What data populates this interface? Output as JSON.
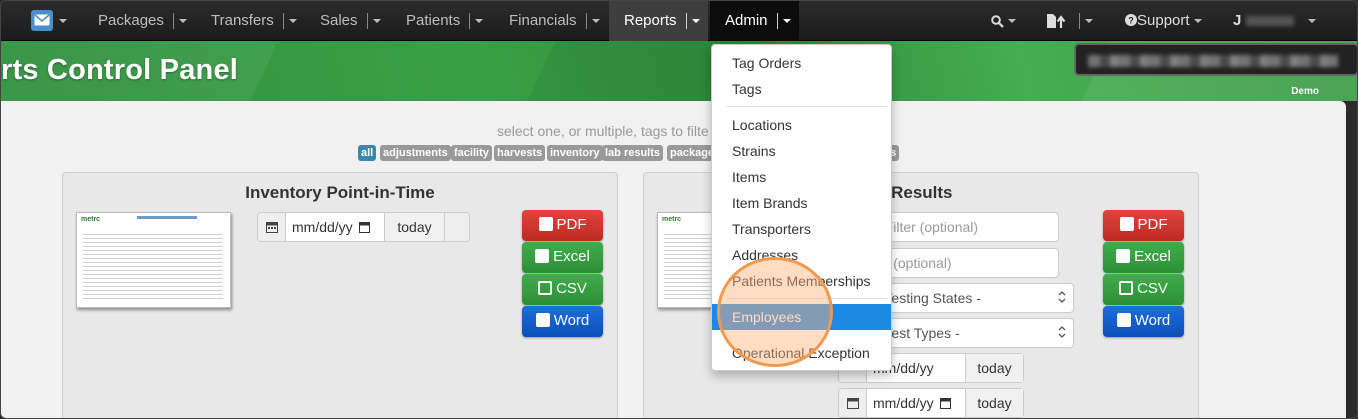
{
  "navbar": {
    "mail_icon": "envelope-icon",
    "items": [
      {
        "label": "Packages"
      },
      {
        "label": "Transfers"
      },
      {
        "label": "Sales"
      },
      {
        "label": "Patients"
      },
      {
        "label": "Financials"
      },
      {
        "label": "Reports"
      },
      {
        "label": "Admin"
      }
    ],
    "support_label": "Support",
    "user_label": "J"
  },
  "banner": {
    "title": "rts Control Panel",
    "demo_label": "Demo"
  },
  "filters": {
    "hint": "select one, or multiple, tags to filte",
    "tags": [
      "all",
      "adjustments",
      "facility",
      "harvests",
      "inventory",
      "lab results",
      "package",
      "rs"
    ]
  },
  "panel_left": {
    "title": "Inventory Point-in-Time",
    "thumb_logo": "metrc",
    "date_placeholder": "mm/dd/yy",
    "today_label": "today"
  },
  "panel_right": {
    "title": "b Results",
    "thumb_logo": "metrc",
    "filter1_placeholder": "e Filter (optional)",
    "filter2_placeholder": "ter (optional)",
    "select1": "b Testing States -",
    "select2": "b Test Types -",
    "date_placeholder": "mm/dd/yy",
    "today_label": "today"
  },
  "export_buttons": {
    "pdf": "PDF",
    "excel": "Excel",
    "csv": "CSV",
    "word": "Word"
  },
  "admin_menu": {
    "items": [
      "Tag Orders",
      "Tags",
      "Locations",
      "Strains",
      "Items",
      "Item Brands",
      "Transporters",
      "Addresses",
      "Patients Memberships",
      "Employees",
      "Operational Exception"
    ]
  },
  "colors": {
    "accent": "#1e88e5",
    "banner_green": "#3aa047",
    "pdf_red": "#c9302c",
    "excel_green": "#34a03f",
    "word_blue": "#1160cc",
    "highlight": "#f19a4e"
  }
}
